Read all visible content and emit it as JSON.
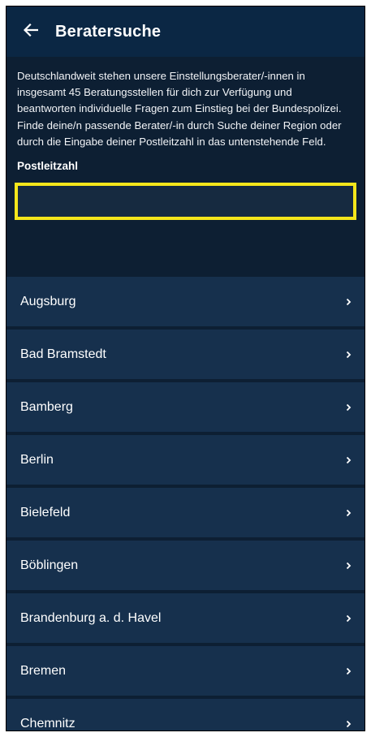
{
  "appbar": {
    "title": "Beratersuche"
  },
  "intro": {
    "text": "Deutschlandweit stehen unsere Einstellungsberater/-innen in insgesamt 45 Beratungsstellen für dich zur Verfügung und beantworten individuelle Fragen zum Einstieg bei der Bundespolizei. Finde deine/n passende Berater/-in durch Suche deiner Region oder durch die Eingabe deiner Postleitzahl in das untenstehende Feld."
  },
  "plz": {
    "label": "Postleitzahl",
    "value": "",
    "placeholder": ""
  },
  "icons": {
    "back": "arrow-left-icon",
    "row_chevron": "chevron-right-icon"
  },
  "colors": {
    "appbar": "#0b2744",
    "background": "#0d1f33",
    "row": "#16304d",
    "focus_highlight": "#f5e61b"
  },
  "locations": [
    {
      "label": "Augsburg"
    },
    {
      "label": "Bad Bramstedt"
    },
    {
      "label": "Bamberg"
    },
    {
      "label": "Berlin"
    },
    {
      "label": "Bielefeld"
    },
    {
      "label": "Böblingen"
    },
    {
      "label": "Brandenburg a. d. Havel"
    },
    {
      "label": "Bremen"
    },
    {
      "label": "Chemnitz"
    }
  ]
}
